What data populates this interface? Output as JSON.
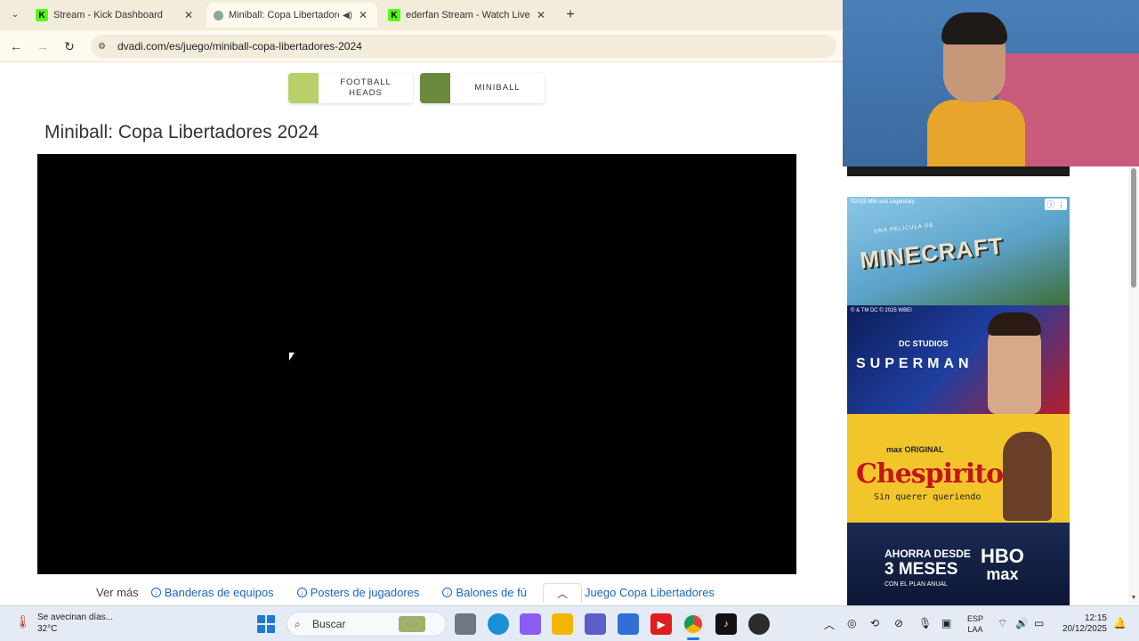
{
  "browser": {
    "tabs": [
      {
        "title": "Stream - Kick Dashboard",
        "favicon": "K"
      },
      {
        "title": "Miniball: Copa Libertadores",
        "favicon": ""
      },
      {
        "title": "ederfan Stream - Watch Live on",
        "favicon": "K"
      }
    ],
    "url": "dvadi.com/es/juego/miniball-copa-libertadores-2024"
  },
  "page": {
    "games": [
      {
        "label_line1": "FOOTBALL",
        "label_line2": "HEADS"
      },
      {
        "label_line1": "MINIBALL",
        "label_line2": ""
      }
    ],
    "title": "Miniball: Copa Libertadores 2024",
    "ver_mas": "Ver más",
    "links": [
      "Banderas de equipos",
      "Posters de jugadores",
      "Balones de fú",
      "Juego Copa Libertadores"
    ]
  },
  "ads": {
    "minecraft": {
      "small": "©2025 MBI and Legendary",
      "sub": "UNA PELÍCULA DE",
      "title": "MINECRAFT"
    },
    "superman": {
      "small": "© & TM DC © 2025 WBEI",
      "logo": "DC STUDIOS",
      "title": "SUPERMAN"
    },
    "chespirito": {
      "brand": "max ORIGINAL",
      "title": "Chespirito",
      "sub": "Sin querer queriendo"
    },
    "hbo": {
      "line1": "AHORRA DESDE",
      "line2": "3 MESES",
      "line3": "CON EL PLAN ANUAL",
      "logo_top": "HBO",
      "logo_bottom": "max"
    }
  },
  "taskbar": {
    "weather_line1": "Se avecinan días...",
    "weather_line2": "32°C",
    "search_placeholder": "Buscar",
    "lang_line1": "ESP",
    "lang_line2": "LAA",
    "time": "12:15",
    "date": "20/12/2025"
  },
  "colors": {
    "link": "#1a66c2",
    "tab_strip": "#f3ecdb",
    "toolbar": "#fff9ee",
    "taskbar": "#e4ebf4"
  }
}
